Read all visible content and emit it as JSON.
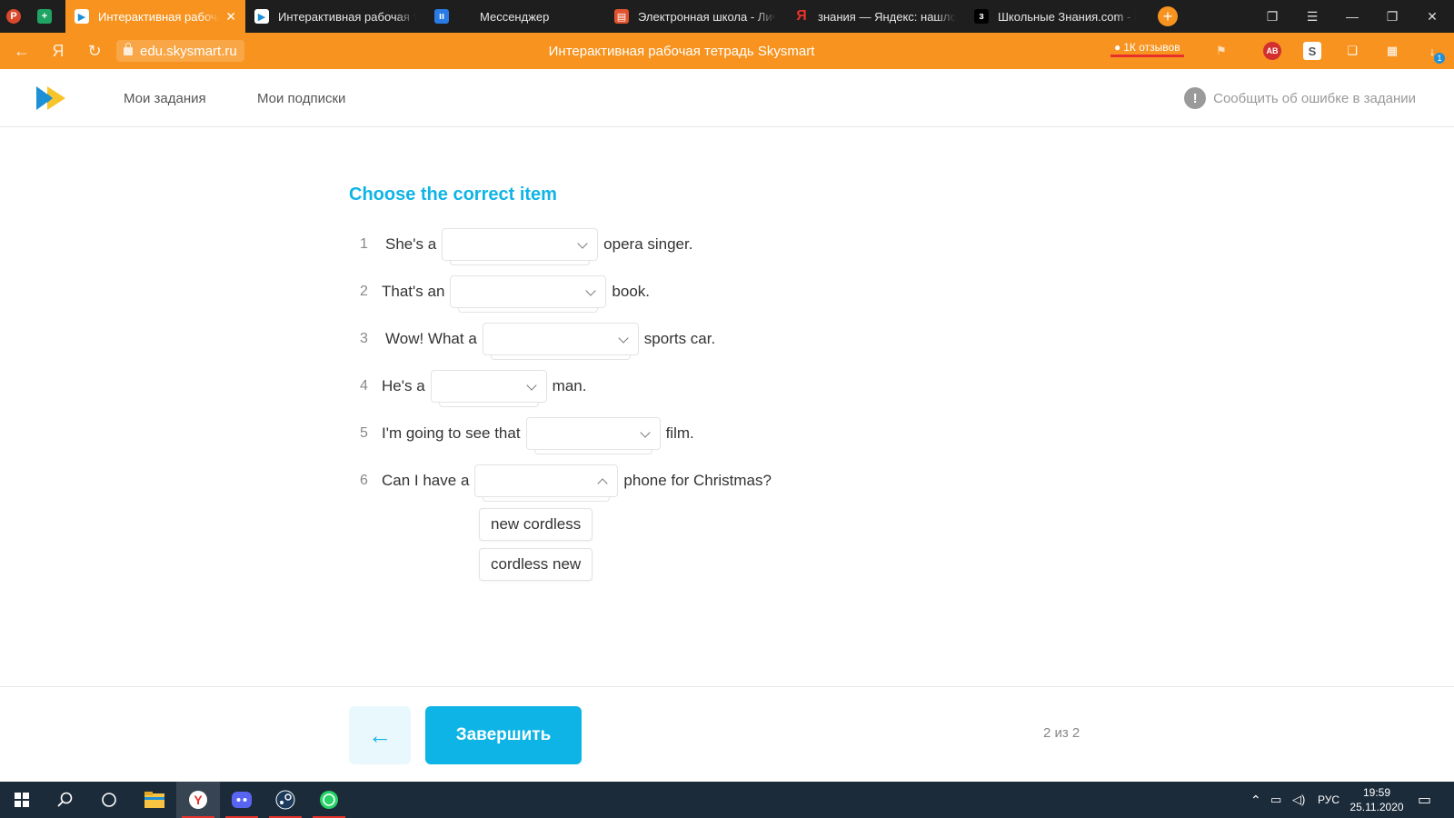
{
  "browser": {
    "tabs": [
      {
        "label": "Интерактивная рабочая тетрадь Skysmart",
        "active": true,
        "fav_color": "#1e90d6"
      },
      {
        "label": "Интерактивная рабочая тетрадь Skysmart",
        "active": false,
        "fav_color": "#1e90d6"
      },
      {
        "label": "Мессенджер",
        "active": false,
        "fav_color": "#2a7be4"
      },
      {
        "label": "Электронная школа - Личный кабинет",
        "active": false,
        "fav_color": "#e0522d"
      },
      {
        "label": "знания — Яндекс: нашлось",
        "active": false,
        "fav_color": "#e8312c"
      },
      {
        "label": "Школьные Знания.com - Реши",
        "active": false,
        "fav_color": "#000000"
      }
    ],
    "new_tab": "+",
    "url": "edu.skysmart.ru",
    "page_title": "Интерактивная рабочая тетрадь Skysmart",
    "reviews": "1К отзывов",
    "ext_badge": "1"
  },
  "site": {
    "nav": {
      "tasks": "Мои задания",
      "subscriptions": "Мои подписки"
    },
    "report": "Сообщить об ошибке в задании",
    "report_icon": "!"
  },
  "task": {
    "title": "Choose the correct item",
    "rows": [
      {
        "num": "1",
        "before": "She's a",
        "after": "opera singer."
      },
      {
        "num": "2",
        "before": "That's an",
        "after": "book."
      },
      {
        "num": "3",
        "before": "Wow! What a",
        "after": "sports car."
      },
      {
        "num": "4",
        "before": "He's a",
        "after": "man."
      },
      {
        "num": "5",
        "before": "I'm going to see that",
        "after": "film."
      },
      {
        "num": "6",
        "before": "Can I have a",
        "after": "phone for Christmas?"
      }
    ],
    "open_options": [
      "new cordless",
      "cordless new"
    ]
  },
  "footer": {
    "back_icon": "←",
    "finish": "Завершить",
    "pager": "2 из 2"
  },
  "taskbar": {
    "lang": "РУС",
    "time": "19:59",
    "date": "25.11.2020"
  },
  "colors": {
    "accent": "#0fb4e6",
    "browser_orange": "#f7931e"
  }
}
